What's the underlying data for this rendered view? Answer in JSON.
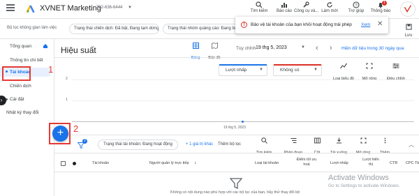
{
  "topbar": {
    "brand": "XVNET Marketing",
    "account_id": "782-636-6444",
    "buttons": [
      {
        "label": "Tìm kiếm",
        "icon": "search-icon"
      },
      {
        "label": "Báo cáo",
        "icon": "bar-chart-icon"
      },
      {
        "label": "Công cụ và...",
        "icon": "wrench-icon"
      },
      {
        "label": "Làm mới",
        "icon": "refresh-icon"
      },
      {
        "label": "Trợ giúp",
        "icon": "help-icon"
      },
      {
        "label": "Thông báo",
        "icon": "bell-icon",
        "badge": "1"
      }
    ]
  },
  "filterbar": {
    "label": "Bộ lọc không gian làm việc",
    "chips": [
      "Trạng thái chiến dịch: Đã bật, Đang tạm dừng",
      "Trạng thái nhóm quảng cáo: Đang bật"
    ],
    "save_label": "Lưu"
  },
  "toast": {
    "message": "Bảo vệ tài khoản của bạn khỏi hoạt động trái phép",
    "link": "Xem"
  },
  "sidebar": {
    "items": [
      {
        "label": "Tổng quan"
      },
      {
        "label": "Thông tin chi tiết"
      },
      {
        "label": "Tài khoản"
      },
      {
        "label": "Chiến dịch"
      },
      {
        "label": "Cài đặt"
      },
      {
        "label": "Nhật ký thay đổi"
      }
    ]
  },
  "annotations": {
    "step1": "1",
    "step2": "2"
  },
  "main": {
    "title": "Hiệu suất",
    "views": [
      {
        "label": "Bảng"
      },
      {
        "label": "Bản đồ"
      }
    ],
    "date_range_label": "Tùy chỉnh",
    "date_value": "19 thg 5, 2023",
    "range_link": "Hiện dữ liệu trong 30 ngày qua",
    "metrics": [
      {
        "label": "Lượt nhấp",
        "color": "#1a73e8"
      },
      {
        "label": "Không có",
        "color": "#d93025"
      }
    ],
    "chart_tools": [
      {
        "label": "Loại biểu đồ",
        "icon": "line-chart-icon"
      },
      {
        "label": "Mở rộng",
        "icon": "expand-icon"
      },
      {
        "label": "Điều chỉnh",
        "icon": "tune-icon"
      }
    ]
  },
  "chart_data": {
    "type": "line",
    "x": [
      "19 thg 5, 2023"
    ],
    "series": [
      {
        "values": [
          0
        ]
      }
    ],
    "y_ticks": [
      "2",
      "1",
      "0"
    ],
    "ylim": [
      0,
      2
    ]
  },
  "table": {
    "fab": "+",
    "filter_count": "2",
    "status_chip": "Trạng thái tài khoản: Đang hoạt động",
    "more_values": "+ 1 giá trị khác",
    "add_filter": "Thêm bộ lọc",
    "tools": [
      {
        "label": "Tìm kiếm",
        "icon": "search-icon"
      },
      {
        "label": "Phân đoạn",
        "icon": "segment-icon"
      },
      {
        "label": "Cột",
        "icon": "columns-icon"
      },
      {
        "label": "Tải xuống",
        "icon": "download-icon"
      },
      {
        "label": "Mở rộng",
        "icon": "expand-icon"
      },
      {
        "label": "Thêm",
        "icon": "more-icon"
      }
    ],
    "headers": {
      "account": "Tài khoản",
      "manager": "Người quản lý trực tiếp",
      "type": "Loại tài khoản",
      "score": "Điểm tối ưu hoá",
      "clicks": "Lượt nhấp",
      "impr": "Lượt hiển thị",
      "ctr": "CTR",
      "cpc": "CPC Tb"
    },
    "empty_text": "Không có nội dung nào phù hợp với các bộ lọc của bạn, hãy thử thay đổi bộ"
  },
  "watermark": {
    "title": "Activate Windows",
    "subtitle": "Go to Settings to activate Windows."
  }
}
